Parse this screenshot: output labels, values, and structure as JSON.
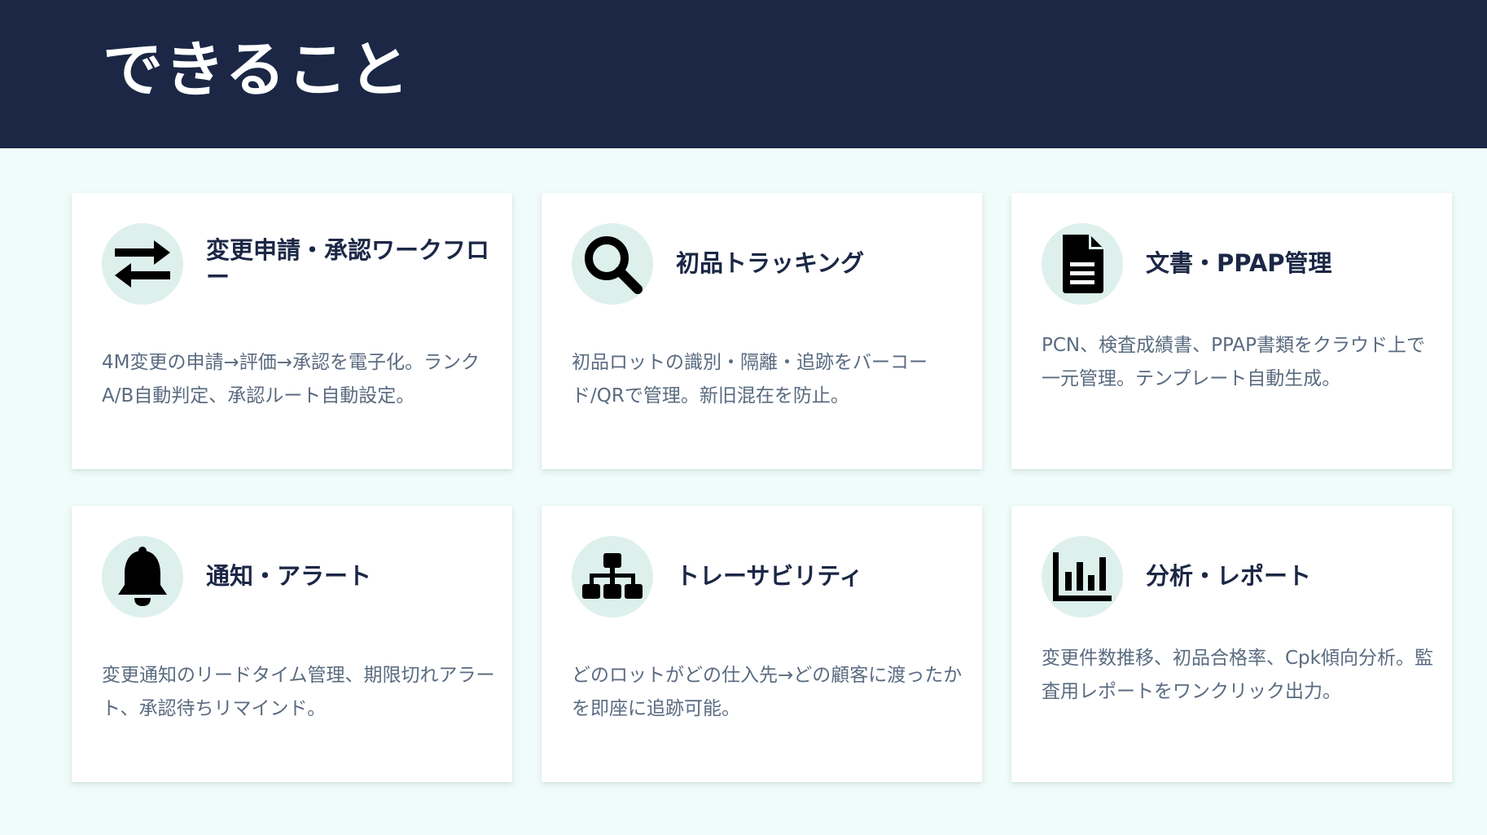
{
  "header": {
    "title": "できること",
    "background": "#1b2745"
  },
  "colors": {
    "page_background": "#effcf9",
    "icon_circle": "#ddf0ec",
    "title_text": "#1b2745",
    "desc_text": "#5a6b80"
  },
  "cards": [
    {
      "icon": "swap-arrows-icon",
      "title": "変更申請・承認ワークフロー",
      "description": "4M変更の申請→評価→承認を電子化。ランクA/B自動判定、承認ルート自動設定。"
    },
    {
      "icon": "search-icon",
      "title": "初品トラッキング",
      "description": "初品ロットの識別・隔離・追跡をバーコード/QRで管理。新旧混在を防止。"
    },
    {
      "icon": "document-icon",
      "title": "文書・PPAP管理",
      "description": "PCN、検査成績書、PPAP書類をクラウド上で一元管理。テンプレート自動生成。"
    },
    {
      "icon": "bell-icon",
      "title": "通知・アラート",
      "description": "変更通知のリードタイム管理、期限切れアラート、承認待ちリマインド。"
    },
    {
      "icon": "sitemap-icon",
      "title": "トレーサビリティ",
      "description": "どのロットがどの仕入先→どの顧客に渡ったかを即座に追跡可能。"
    },
    {
      "icon": "bar-chart-icon",
      "title": "分析・レポート",
      "description": "変更件数推移、初品合格率、Cpk傾向分析。監査用レポートをワンクリック出力。"
    }
  ]
}
